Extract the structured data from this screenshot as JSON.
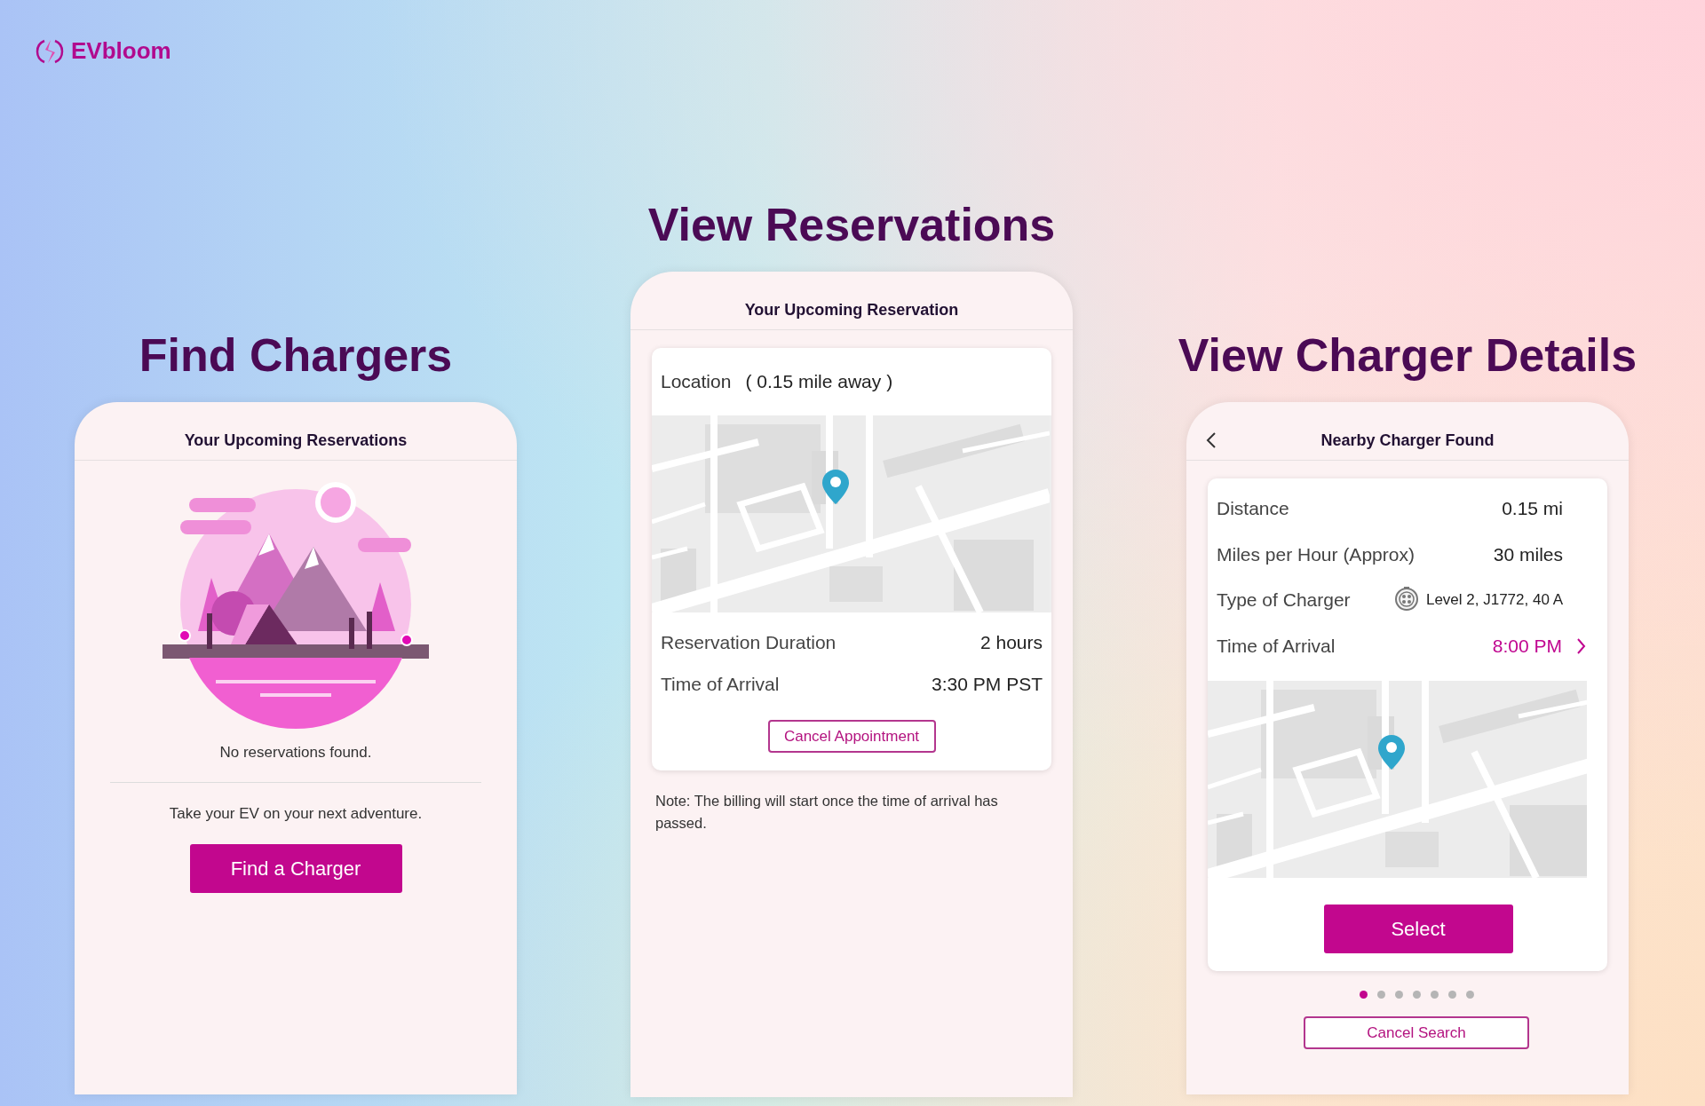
{
  "brand": {
    "name": "EVbloom"
  },
  "screens": [
    {
      "kind": "empty",
      "title": "Find Chargers",
      "header": "Your Upcoming Reservations",
      "message": "No reservations found.",
      "prompt": "Take your EV on your next adventure.",
      "button": "Find a Charger"
    },
    {
      "kind": "reservation",
      "title": "View Reservations",
      "header": "Your Upcoming Reservation",
      "location_label": "Location",
      "location_distance": "( 0.15 mile away )",
      "details": [
        {
          "label": "Reservation Duration",
          "value": "2 hours"
        },
        {
          "label": "Time of Arrival",
          "value": "3:30 PM PST"
        }
      ],
      "button": "Cancel Appointment",
      "note": "Note: The billing will start once the time of arrival has passed."
    },
    {
      "kind": "charger",
      "title": "View Charger Details",
      "header": "Nearby Charger Found",
      "details": [
        {
          "kind": "plain",
          "label": "Distance",
          "value": "0.15 mi"
        },
        {
          "kind": "plain",
          "label": "Miles per Hour (Approx)",
          "value": "30 miles"
        },
        {
          "kind": "connector",
          "label": "Type of Charger",
          "value": "Level 2, J1772, 40 A"
        },
        {
          "kind": "link",
          "label": "Time of Arrival",
          "value": "8:00 PM"
        }
      ],
      "primary_button": "Select",
      "pages": [
        {
          "selected": true
        },
        {
          "selected": false
        },
        {
          "selected": false
        },
        {
          "selected": false
        },
        {
          "selected": false
        },
        {
          "selected": false
        },
        {
          "selected": false
        }
      ],
      "secondary_button": "Cancel Search"
    }
  ]
}
